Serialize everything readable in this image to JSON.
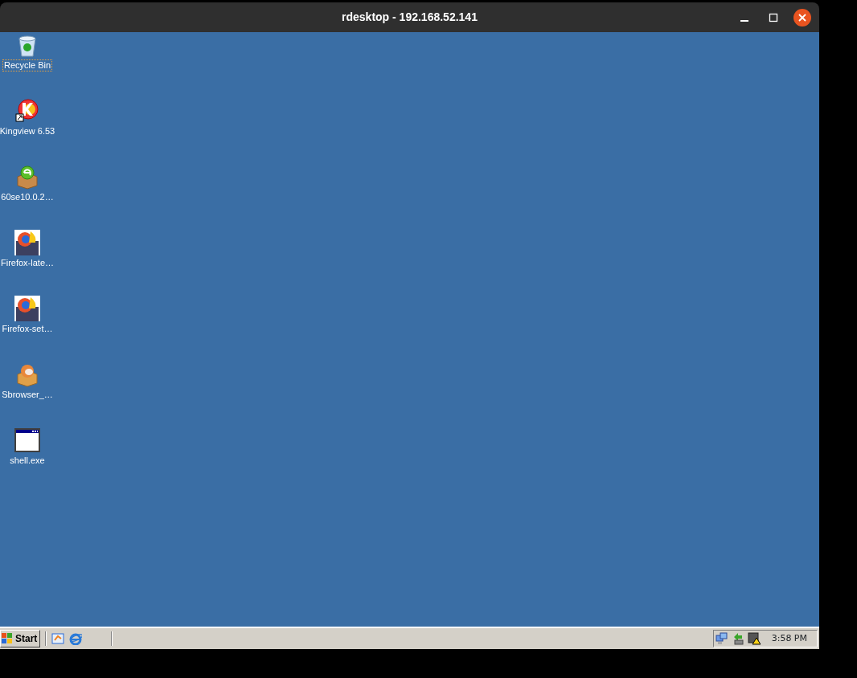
{
  "window": {
    "title": "rdesktop - 192.168.52.141"
  },
  "desktop_icons": [
    {
      "label": "Recycle Bin",
      "kind": "recycle",
      "selected": true
    },
    {
      "label": "Kingview 6.53",
      "kind": "kingview",
      "selected": false
    },
    {
      "label": "60se10.0.2…",
      "kind": "box-e",
      "selected": false
    },
    {
      "label": "Firefox-late…",
      "kind": "firefox",
      "selected": false
    },
    {
      "label": "Firefox-set…",
      "kind": "firefox",
      "selected": false
    },
    {
      "label": "Sbrowser_…",
      "kind": "box-ball",
      "selected": false
    },
    {
      "label": "shell.exe",
      "kind": "window",
      "selected": false
    }
  ],
  "taskbar": {
    "start": "Start",
    "quick_launch": [
      {
        "kind": "desktop"
      },
      {
        "kind": "ie"
      }
    ],
    "tray": [
      {
        "kind": "network"
      },
      {
        "kind": "usb"
      },
      {
        "kind": "vm-warning"
      }
    ],
    "clock": "3:58 PM"
  }
}
